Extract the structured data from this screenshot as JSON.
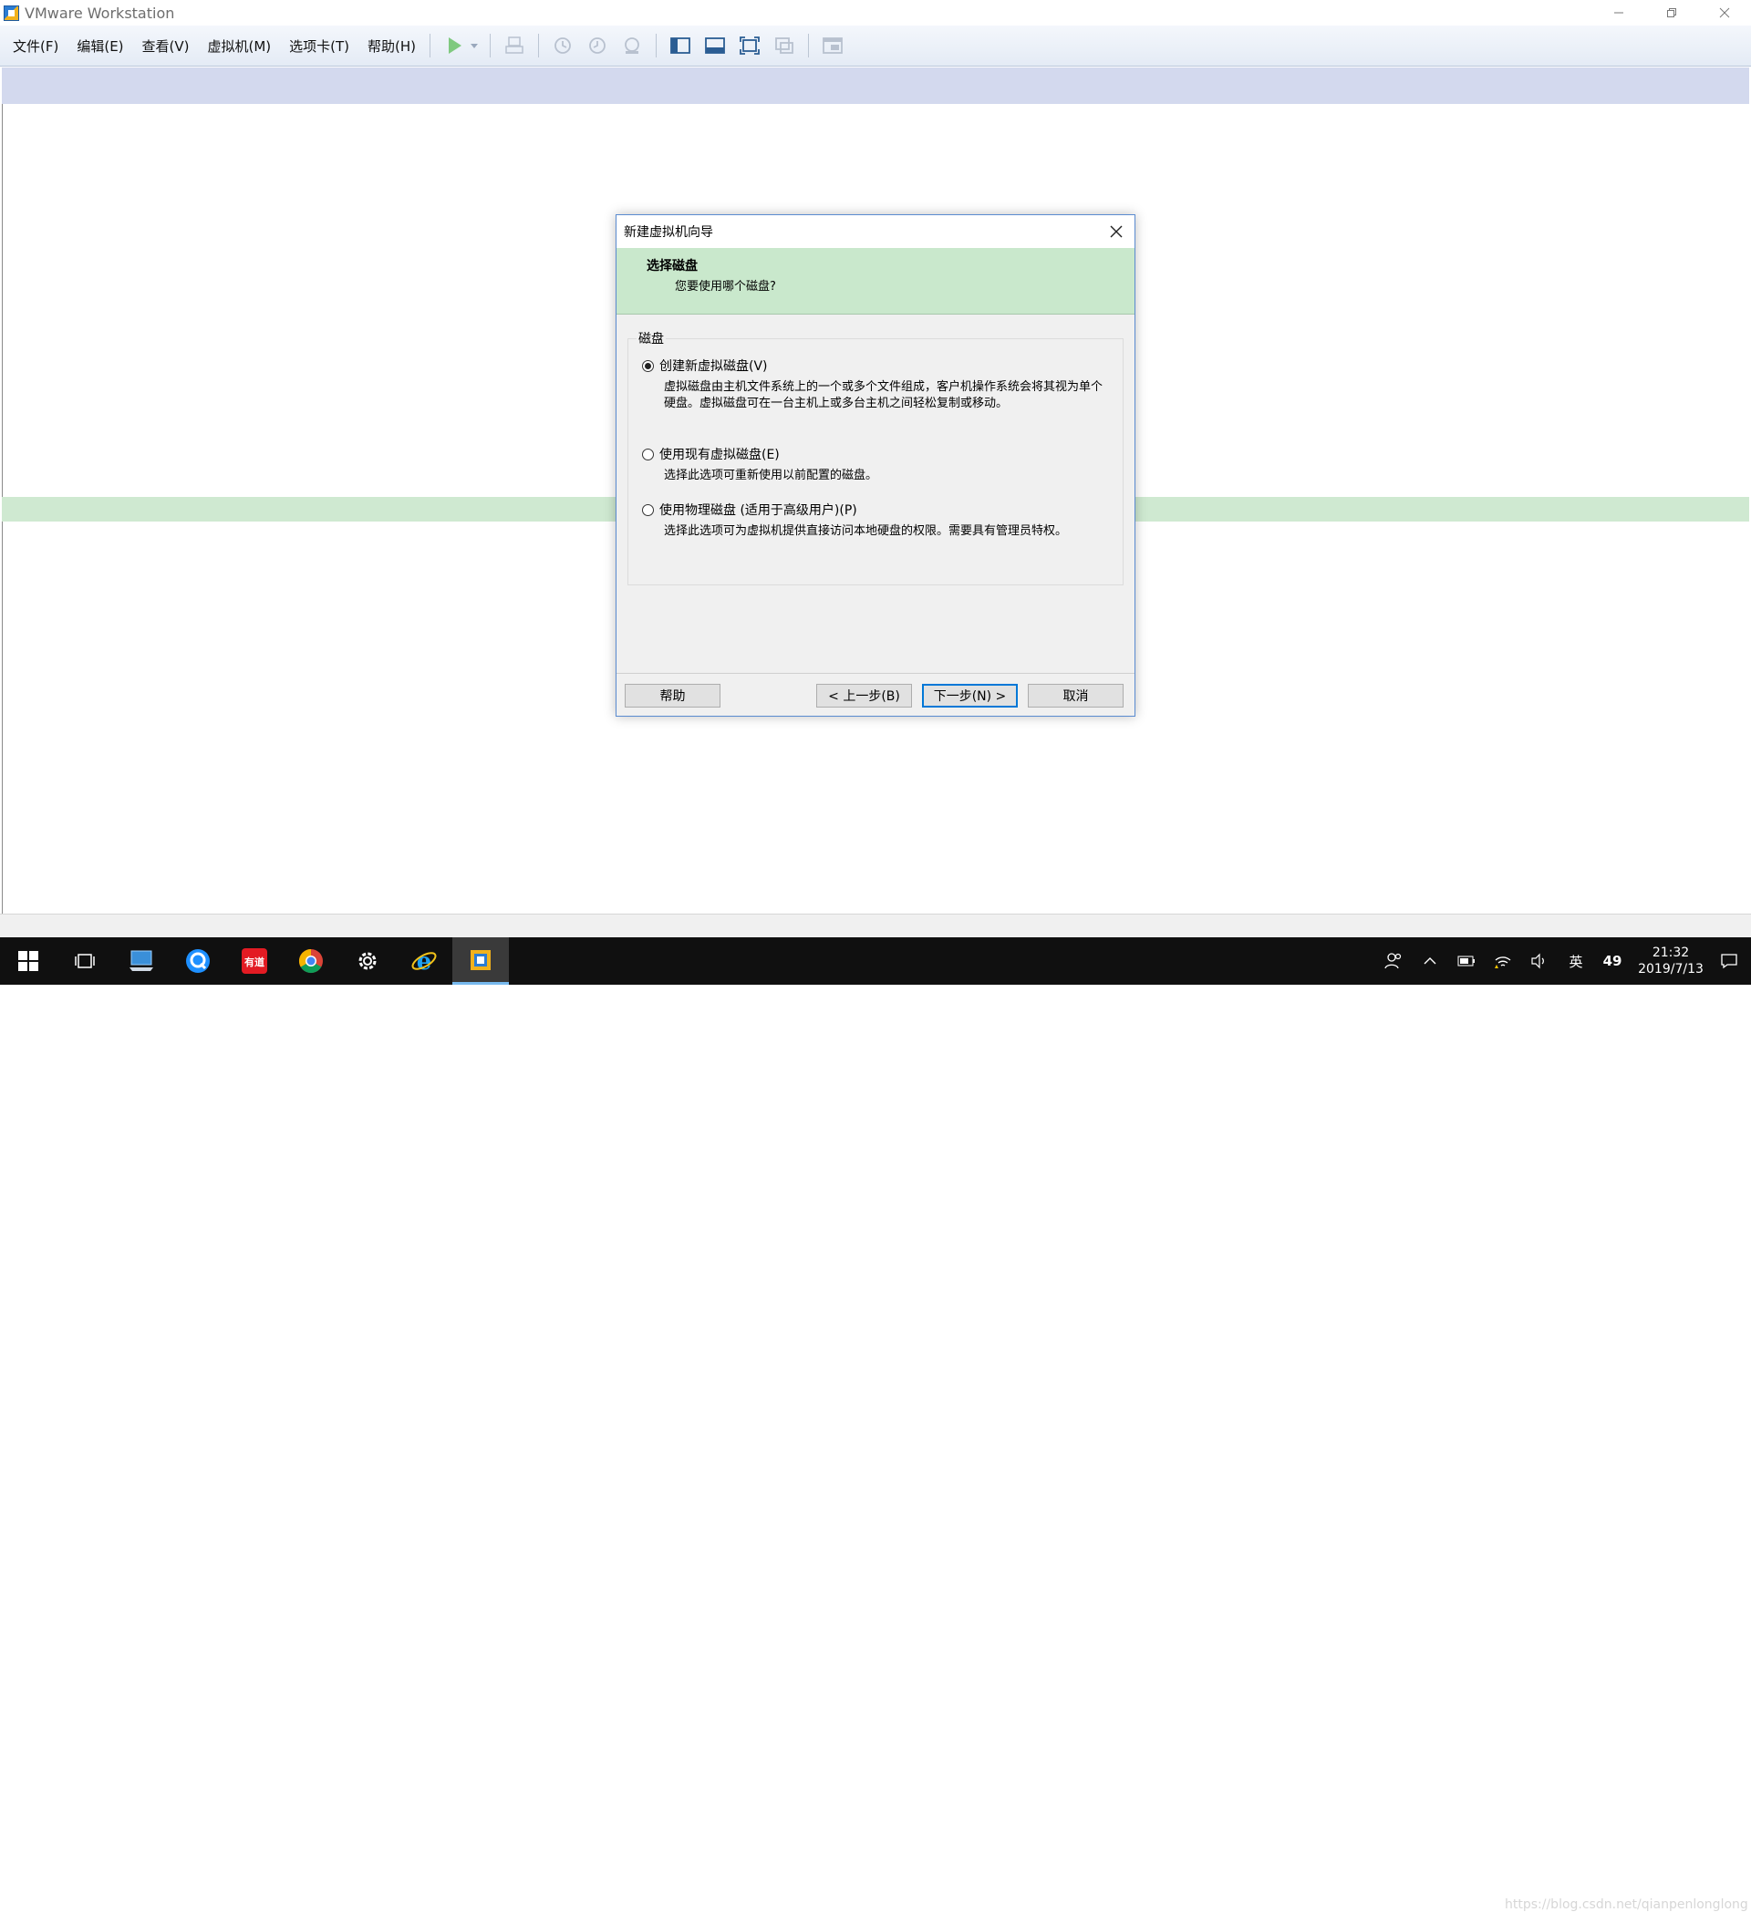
{
  "window": {
    "title": "VMware Workstation",
    "controls": [
      "minimize",
      "restore",
      "close"
    ]
  },
  "menu": {
    "items": [
      "文件(F)",
      "编辑(E)",
      "查看(V)",
      "虚拟机(M)",
      "选项卡(T)",
      "帮助(H)"
    ]
  },
  "toolbar": {
    "icons": [
      "play-icon",
      "dropdown-arrow-icon",
      "send-keys-icon",
      "snapshot-icon",
      "revert-snapshot-icon",
      "snapshot-manager-icon",
      "sidebar-view-icon",
      "thumbnail-bar-icon",
      "fullscreen-icon",
      "unity-icon",
      "console-view-icon"
    ]
  },
  "dialog": {
    "title": "新建虚拟机向导",
    "header_title": "选择磁盘",
    "header_subtitle": "您要使用哪个磁盘?",
    "group_label": "磁盘",
    "options": [
      {
        "label": "创建新虚拟磁盘(V)",
        "description": "虚拟磁盘由主机文件系统上的一个或多个文件组成，客户机操作系统会将其视为单个硬盘。虚拟磁盘可在一台主机上或多台主机之间轻松复制或移动。",
        "checked": true
      },
      {
        "label": "使用现有虚拟磁盘(E)",
        "description": "选择此选项可重新使用以前配置的磁盘。",
        "checked": false
      },
      {
        "label": "使用物理磁盘 (适用于高级用户)(P)",
        "description": "选择此选项可为虚拟机提供直接访问本地硬盘的权限。需要具有管理员特权。",
        "checked": false
      }
    ],
    "buttons": {
      "help": "帮助",
      "back": "< 上一步(B)",
      "next": "下一步(N) >",
      "cancel": "取消"
    }
  },
  "taskbar": {
    "apps": [
      "windows-start-icon",
      "task-view-icon",
      "computer-icon",
      "browser-q-icon",
      "youdao-icon",
      "chrome-icon",
      "settings-icon",
      "ie-icon",
      "vmware-icon"
    ],
    "youdao_label": "有道",
    "tray": {
      "ime": "英",
      "badge": "49",
      "time": "21:32",
      "date": "2019/7/13"
    },
    "watermark": "https://blog.csdn.net/qianpenlonglong"
  }
}
